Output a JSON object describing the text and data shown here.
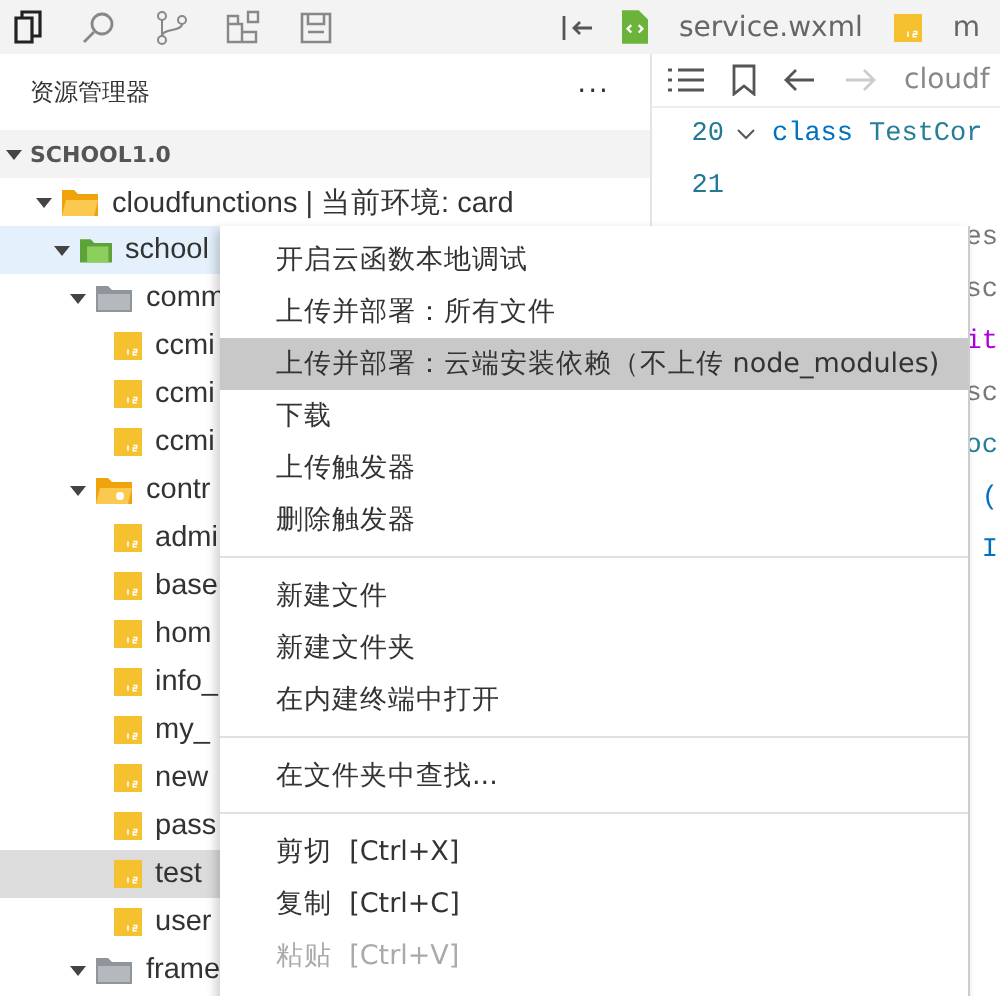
{
  "activity_bar": [
    {
      "kind": "files",
      "selected": true
    },
    {
      "kind": "search",
      "selected": false
    },
    {
      "kind": "branch",
      "selected": false
    },
    {
      "kind": "blocks",
      "selected": false
    },
    {
      "kind": "save",
      "selected": false
    }
  ],
  "tabs": [
    {
      "label": "service.wxml",
      "kind": "wxml"
    },
    {
      "label": "m",
      "kind": "js"
    }
  ],
  "explorer": {
    "title": "资源管理器",
    "more": "···",
    "root": "SCHOOL1.0",
    "expanded": true,
    "children": [
      {
        "label": "cloudfunctions | 当前环境: card",
        "kind": "cloud-folder",
        "expanded": true,
        "selected": false,
        "children": [
          {
            "label": "school",
            "kind": "function-folder",
            "expanded": true,
            "selected": true,
            "children": [
              {
                "label": "comm",
                "kind": "folder",
                "expanded": true,
                "selected": false,
                "children": [
                  {
                    "label": "ccmi",
                    "kind": "js",
                    "selected": false
                  },
                  {
                    "label": "ccmi",
                    "kind": "js",
                    "selected": false
                  },
                  {
                    "label": "ccmi",
                    "kind": "js",
                    "selected": false
                  }
                ]
              },
              {
                "label": "contr",
                "kind": "special-folder",
                "expanded": true,
                "selected": false,
                "children": [
                  {
                    "label": "admi",
                    "kind": "js",
                    "selected": false
                  },
                  {
                    "label": "base",
                    "kind": "js",
                    "selected": false
                  },
                  {
                    "label": "hom",
                    "kind": "js",
                    "selected": false
                  },
                  {
                    "label": "info_",
                    "kind": "js",
                    "selected": false
                  },
                  {
                    "label": "my_",
                    "kind": "js",
                    "selected": false
                  },
                  {
                    "label": "new",
                    "kind": "js",
                    "selected": false
                  },
                  {
                    "label": "pass",
                    "kind": "js",
                    "selected": false
                  },
                  {
                    "label": "test",
                    "kind": "js",
                    "selected": true
                  },
                  {
                    "label": "user",
                    "kind": "js",
                    "selected": false
                  }
                ]
              },
              {
                "label": "frame",
                "kind": "folder",
                "expanded": true,
                "selected": false
              }
            ]
          }
        ]
      }
    ]
  },
  "editor": {
    "breadcrumb": "cloudf",
    "lines": [
      {
        "number": "20",
        "fold": true,
        "tokens": [
          {
            "text": "class",
            "kind": "keyword"
          },
          {
            "text": "TestCor",
            "kind": "type"
          }
        ]
      },
      {
        "number": "21"
      },
      {
        "tokens": [
          {
            "text": "es",
            "kind": "plain"
          }
        ]
      },
      {
        "tokens": [
          {
            "text": "sc",
            "kind": "plain"
          }
        ]
      },
      {
        "tokens": [
          {
            "text": "it",
            "kind": "control"
          }
        ]
      },
      {
        "tokens": [
          {
            "text": "sc",
            "kind": "plain"
          }
        ]
      },
      {
        "tokens": [
          {
            "text": "oc",
            "kind": "type"
          }
        ]
      },
      {
        "tokens": [
          {
            "text": "(",
            "kind": "keyword"
          }
        ]
      },
      {
        "tokens": [
          {
            "text": "I",
            "kind": "keyword"
          }
        ]
      }
    ]
  },
  "context_menu": [
    {
      "kind": "item",
      "label": "开启云函数本地调试",
      "selected": false,
      "disabled": false
    },
    {
      "kind": "item",
      "label": "上传并部署：所有文件",
      "selected": false,
      "disabled": false
    },
    {
      "kind": "item",
      "label": "上传并部署：云端安装依赖（不上传 node_modules)",
      "selected": true,
      "disabled": false
    },
    {
      "kind": "item",
      "label": "下载",
      "selected": false,
      "disabled": false
    },
    {
      "kind": "item",
      "label": "上传触发器",
      "selected": false,
      "disabled": false
    },
    {
      "kind": "item",
      "label": "删除触发器",
      "selected": false,
      "disabled": false
    },
    {
      "kind": "separator"
    },
    {
      "kind": "item",
      "label": "新建文件",
      "selected": false,
      "disabled": false
    },
    {
      "kind": "item",
      "label": "新建文件夹",
      "selected": false,
      "disabled": false
    },
    {
      "kind": "item",
      "label": "在内建终端中打开",
      "selected": false,
      "disabled": false
    },
    {
      "kind": "separator"
    },
    {
      "kind": "item",
      "label": "在文件夹中查找...",
      "selected": false,
      "disabled": false
    },
    {
      "kind": "separator"
    },
    {
      "kind": "item",
      "label": "剪切  [Ctrl+X]",
      "selected": false,
      "disabled": false
    },
    {
      "kind": "item",
      "label": "复制  [Ctrl+C]",
      "selected": false,
      "disabled": false
    },
    {
      "kind": "item",
      "label": "粘贴  [Ctrl+V]",
      "selected": false,
      "disabled": true
    }
  ]
}
